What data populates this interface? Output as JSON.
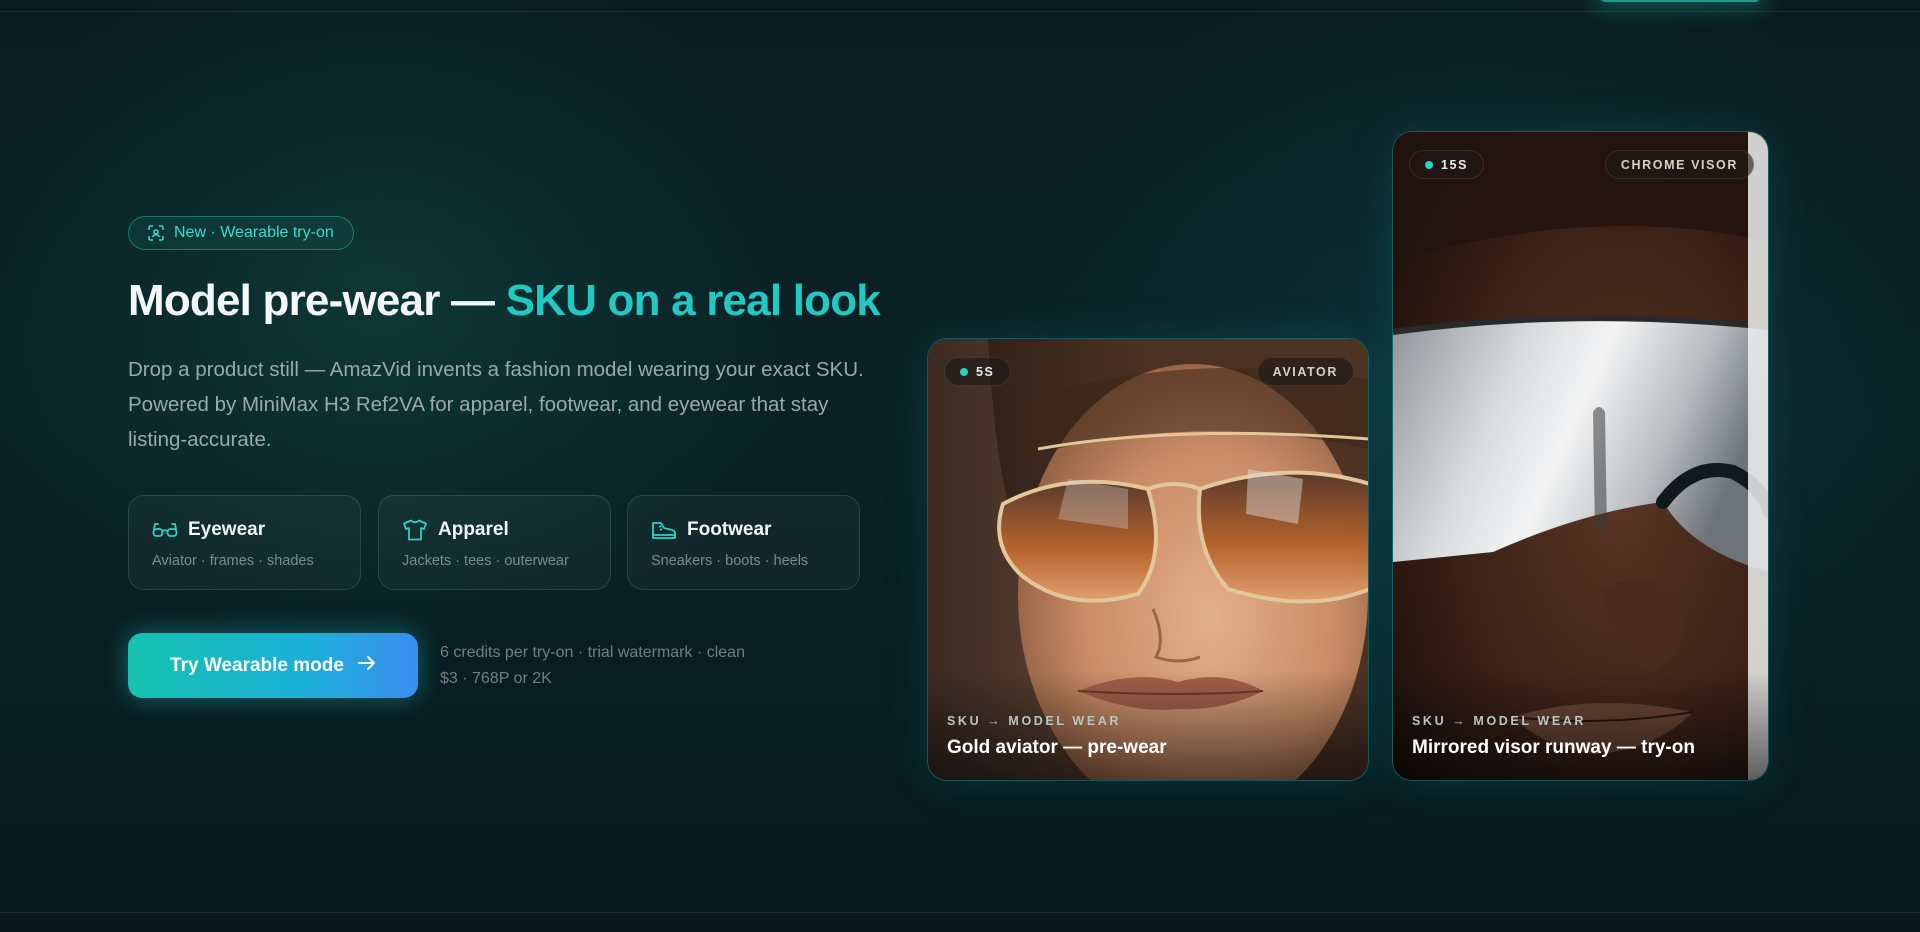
{
  "badge": {
    "icon": "scan-icon",
    "label": "New · Wearable try-on"
  },
  "hero": {
    "title_main": "Model pre-wear — ",
    "title_accent": "SKU on a real look",
    "description": "Drop a product still — AmazVid invents a fashion model wearing your exact SKU. Powered by MiniMax H3 Ref2VA for apparel, footwear, and eyewear that stay listing-accurate."
  },
  "categories": [
    {
      "icon": "glasses-icon",
      "name": "Eyewear",
      "subtitle": "Aviator · frames · shades"
    },
    {
      "icon": "tshirt-icon",
      "name": "Apparel",
      "subtitle": "Jackets · tees · outerwear"
    },
    {
      "icon": "sneaker-icon",
      "name": "Footwear",
      "subtitle": "Sneakers · boots · heels"
    }
  ],
  "cta": {
    "label": "Try Wearable mode",
    "icon": "arrow-right-icon",
    "note": "6 credits per try-on · trial watermark · clean $3 · 768P or 2K"
  },
  "showcase": [
    {
      "duration": "5S",
      "tag": "AVIATOR",
      "kicker": "SKU → MODEL WEAR",
      "title": "Gold aviator — pre-wear"
    },
    {
      "duration": "15S",
      "tag": "CHROME VISOR",
      "kicker": "SKU → MODEL WEAR",
      "title": "Mirrored visor runway — try-on"
    }
  ],
  "colors": {
    "accent": "#22c8c2",
    "background": "#0a2226",
    "cta_start": "#15c2ae",
    "cta_end": "#3a8ef0"
  }
}
